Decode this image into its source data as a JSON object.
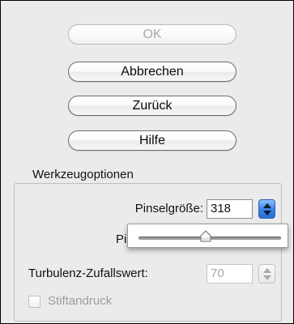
{
  "buttons": {
    "ok": "OK",
    "cancel": "Abbrechen",
    "back": "Zurück",
    "help": "Hilfe"
  },
  "tool_options": {
    "title": "Werkzeugoptionen",
    "brush_size": {
      "label": "Pinselgröße:",
      "value": "318",
      "slider_fraction": 0.47
    },
    "obscured_label": "Pi",
    "turbulence": {
      "label": "Turbulenz-Zufallswert:",
      "value": "70",
      "enabled": false
    },
    "pen_pressure": {
      "label": "Stiftandruck",
      "checked": false,
      "enabled": false
    }
  },
  "colors": {
    "panel_bg": "#ebebeb",
    "stepper_active": "#3a83ea",
    "disabled_text": "#9c9c9c"
  }
}
